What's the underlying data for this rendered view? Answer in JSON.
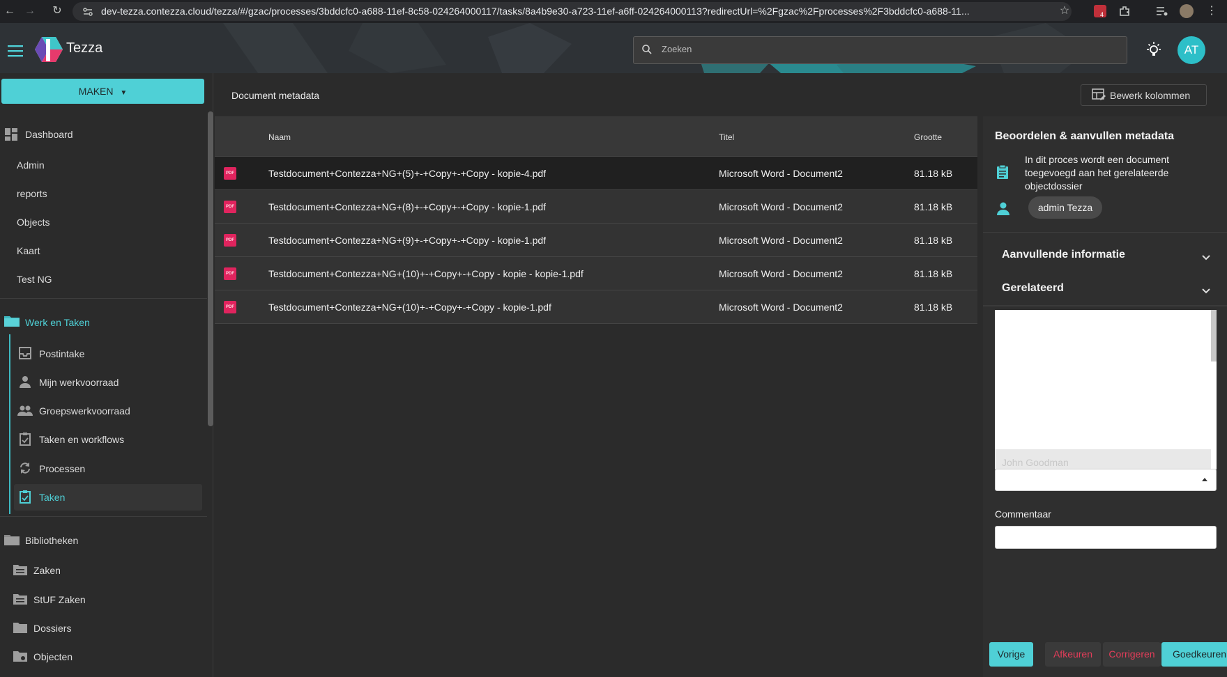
{
  "browser": {
    "url": "dev-tezza.contezza.cloud/tezza/#/gzac/processes/3bddcfc0-a688-11ef-8c58-024264000117/tasks/8a4b9e30-a723-11ef-a6ff-024264000113?redirectUrl=%2Fgzac%2Fprocesses%2F3bddcfc0-a688-11...",
    "extension_badge": "4"
  },
  "header": {
    "app_title": "Tezza",
    "search_placeholder": "Zoeken",
    "avatar_initials": "AT"
  },
  "sidebar": {
    "make_button": "MAKEN",
    "top_items": [
      {
        "label": "Dashboard",
        "icon": "dashboard-icon"
      },
      {
        "label": "Admin"
      },
      {
        "label": "reports"
      },
      {
        "label": "Objects"
      },
      {
        "label": "Kaart"
      },
      {
        "label": "Test NG"
      }
    ],
    "work_section": {
      "label": "Werk en Taken",
      "icon": "folder-icon",
      "items": [
        {
          "label": "Postintake",
          "icon": "inbox-icon"
        },
        {
          "label": "Mijn werkvoorraad",
          "icon": "person-icon"
        },
        {
          "label": "Groepswerkvoorraad",
          "icon": "group-icon"
        },
        {
          "label": "Taken en workflows",
          "icon": "clipboard-icon"
        },
        {
          "label": "Processen",
          "icon": "sync-icon"
        },
        {
          "label": "Taken",
          "icon": "clipboard-icon",
          "active": true
        }
      ]
    },
    "libraries_section": {
      "label": "Bibliotheken",
      "icon": "folder-icon",
      "items": [
        {
          "label": "Zaken",
          "icon": "folder-icon"
        },
        {
          "label": "StUF Zaken",
          "icon": "folder-icon"
        },
        {
          "label": "Dossiers",
          "icon": "folder-icon"
        },
        {
          "label": "Objecten",
          "icon": "folder-icon"
        }
      ]
    }
  },
  "main": {
    "title": "Document metadata",
    "edit_columns_button": "Bewerk kolommen",
    "columns": [
      "Naam",
      "Titel",
      "Grootte"
    ],
    "rows": [
      {
        "name": "Testdocument+Contezza+NG+(5)+-+Copy+-+Copy - kopie-4.pdf",
        "title": "Microsoft Word - Document2",
        "size": "81.18 kB",
        "selected": true
      },
      {
        "name": "Testdocument+Contezza+NG+(8)+-+Copy+-+Copy - kopie-1.pdf",
        "title": "Microsoft Word - Document2",
        "size": "81.18 kB"
      },
      {
        "name": "Testdocument+Contezza+NG+(9)+-+Copy+-+Copy - kopie-1.pdf",
        "title": "Microsoft Word - Document2",
        "size": "81.18 kB"
      },
      {
        "name": "Testdocument+Contezza+NG+(10)+-+Copy+-+Copy - kopie - kopie-1.pdf",
        "title": "Microsoft Word - Document2",
        "size": "81.18 kB"
      },
      {
        "name": "Testdocument+Contezza+NG+(10)+-+Copy+-+Copy - kopie-1.pdf",
        "title": "Microsoft Word - Document2",
        "size": "81.18 kB"
      }
    ],
    "file_icon_label": "PDF"
  },
  "panel": {
    "title": "Beoordelen & aanvullen metadata",
    "description": "In dit proces wordt een document toegevoegd aan het gerelateerde objectdossier",
    "assignee": "admin Tezza",
    "accordions": [
      "Aanvullende informatie",
      "Gerelateerd"
    ],
    "list_item": "John Goodman",
    "comment_label": "Commentaar",
    "buttons": {
      "previous": "Vorige",
      "reject": "Afkeuren",
      "correct": "Corrigeren",
      "approve": "Goedkeuren"
    }
  },
  "colors": {
    "accent": "#4fd0d6",
    "danger": "#e53d5a",
    "background": "#2b2b2b"
  }
}
